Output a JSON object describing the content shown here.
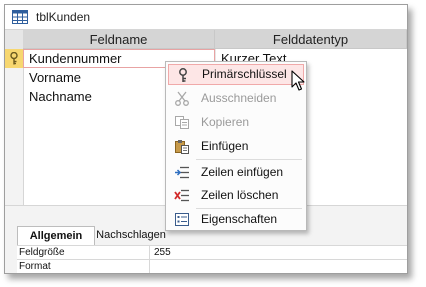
{
  "window": {
    "title": "tblKunden",
    "icon": "table-icon"
  },
  "grid": {
    "headers": [
      "Feldname",
      "Felddatentyp"
    ],
    "rows": [
      {
        "name": "Kundennummer",
        "type": "Kurzer Text",
        "primary_key": true
      },
      {
        "name": "Vorname",
        "type": ""
      },
      {
        "name": "Nachname",
        "type": ""
      }
    ]
  },
  "properties": {
    "tabs": [
      "Allgemein",
      "Nachschlagen"
    ],
    "active_tab": "Allgemein",
    "rows": [
      {
        "label": "Feldgröße",
        "value": "255"
      },
      {
        "label": "Format",
        "value": ""
      }
    ]
  },
  "context_menu": {
    "items": [
      {
        "label": "Primärschlüssel",
        "icon": "key-icon",
        "enabled": true,
        "highlighted": true
      },
      {
        "label": "Ausschneiden",
        "icon": "scissors-icon",
        "enabled": false
      },
      {
        "label": "Kopieren",
        "icon": "copy-icon",
        "enabled": false
      },
      {
        "label": "Einfügen",
        "icon": "paste-icon",
        "enabled": true
      },
      {
        "label": "Zeilen einfügen",
        "icon": "insert-rows-icon",
        "enabled": true
      },
      {
        "label": "Zeilen löschen",
        "icon": "delete-rows-icon",
        "enabled": true
      },
      {
        "label": "Eigenschaften",
        "icon": "properties-icon",
        "enabled": true
      }
    ]
  },
  "colors": {
    "active_row_selector": "#f7d770",
    "highlight_bg": "#fde6e6",
    "highlight_border": "#f0a9a9",
    "header_bg": "#d5d5d5"
  }
}
